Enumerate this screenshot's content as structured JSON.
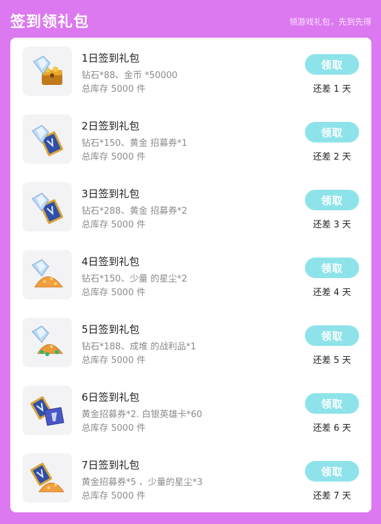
{
  "header": {
    "title": "签到领礼包",
    "subtitle": "领游戏礼包，先到先得"
  },
  "colors": {
    "background": "#dc78f0",
    "button": "#8ee3ea",
    "panel": "#ffffff"
  },
  "rows": [
    {
      "name": "1日签到礼包",
      "desc": "钻石*88、金币 *50000",
      "stock": "总库存 5000 件",
      "button": "领取",
      "remain": "还差 1 天",
      "icon": "diamond-treasure-chest-icon"
    },
    {
      "name": "2日签到礼包",
      "desc": "钻石*150、黄金 招募券*1",
      "stock": "总库存 5000 件",
      "button": "领取",
      "remain": "还差 2 天",
      "icon": "diamond-gold-ticket-icon"
    },
    {
      "name": "3日签到礼包",
      "desc": "钻石*288、黄金 招募券*2",
      "stock": "总库存 5000 件",
      "button": "领取",
      "remain": "还差 3 天",
      "icon": "diamond-gold-ticket-icon"
    },
    {
      "name": "4日签到礼包",
      "desc": "钻石*150、少量 的星尘*2",
      "stock": "总库存 5000 件",
      "button": "领取",
      "remain": "还差 4 天",
      "icon": "diamond-stardust-icon"
    },
    {
      "name": "5日签到礼包",
      "desc": "钻石*188、成堆 的战利品*1",
      "stock": "总库存 5000 件",
      "button": "领取",
      "remain": "还差 5 天",
      "icon": "diamond-loot-pile-icon"
    },
    {
      "name": "6日签到礼包",
      "desc": "黄金招募券*2. 白银英雄卡*60",
      "stock": "总库存 5000 件",
      "button": "领取",
      "remain": "还差 6 天",
      "icon": "ticket-hero-card-icon"
    },
    {
      "name": "7日签到礼包",
      "desc": "黄金招募券*5 、少量的星尘*3",
      "stock": "总库存 5000 件",
      "button": "领取",
      "remain": "还差 7 天",
      "icon": "ticket-stardust-icon"
    }
  ]
}
